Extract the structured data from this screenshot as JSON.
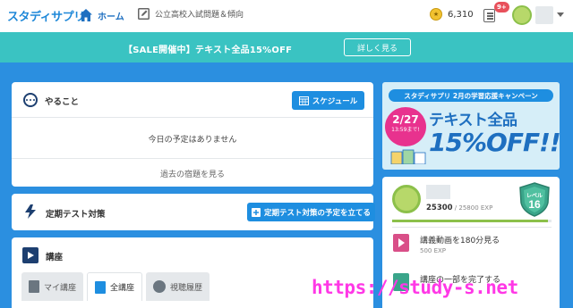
{
  "header": {
    "logo": "スタディサプリ",
    "nav_home": "ホーム",
    "nav_exam": "公立高校入試問題＆傾向",
    "coins": "6,310",
    "notification_badge": "9+"
  },
  "sale_banner": {
    "text": "【SALE開催中】テキスト全品15%OFF",
    "button": "詳しく見る"
  },
  "todo": {
    "title": "やること",
    "schedule_button": "スケジュール",
    "empty_message": "今日の予定はありません",
    "past_homework": "過去の宿題を見る"
  },
  "test": {
    "title": "定期テスト対策",
    "button": "定期テスト対策の予定を立てる"
  },
  "course": {
    "title": "講座",
    "tabs": [
      {
        "label": "マイ講座"
      },
      {
        "label": "全講座"
      },
      {
        "label": "視聴履歴"
      }
    ]
  },
  "campaign": {
    "ribbon": "スタディサプリ 2月の学習応援キャンペーン",
    "date": "2/27",
    "until": "13:59まで!",
    "line1": "テキスト全品",
    "line2": "15%OFF!!"
  },
  "level": {
    "exp_current": "25300",
    "exp_total": " / 25800 EXP",
    "progress": 0.98,
    "level_label": "レベル",
    "level_number": "16",
    "missions": [
      {
        "title": "講義動画を180分見る",
        "exp": "500 EXP"
      },
      {
        "title": "講座の一部を完了する"
      }
    ]
  },
  "watermark": "https://study-s.net",
  "colors": {
    "primary_blue": "#1e8ee0",
    "teal_banner": "#3ac3c2",
    "page_bg": "#2b8fe0",
    "watermark": "#ff38e6"
  }
}
